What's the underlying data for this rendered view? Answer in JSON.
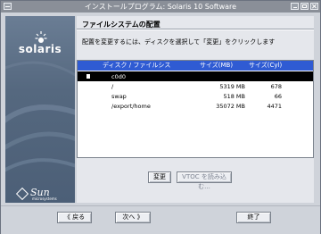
{
  "window": {
    "title": "インストールプログラム: Solaris 10 Software"
  },
  "sidebar": {
    "product_logo": "solaris",
    "vendor_logo": "Sun",
    "vendor_tagline": "microsystems"
  },
  "main": {
    "section_title": "ファイルシステムの配置",
    "instruction": "配置を変更するには、ディスクを選択して「変更」をクリックします",
    "table": {
      "headers": [
        "ディスク / ファイルシス",
        "サイズ(MB)",
        "サイズ(Cyl)"
      ],
      "rows": [
        {
          "name": "c0d0",
          "size_mb": "",
          "size_cyl": "",
          "type": "disk",
          "selected": true
        },
        {
          "name": "/",
          "size_mb": "5319 MB",
          "size_cyl": "678",
          "type": "fs",
          "selected": false
        },
        {
          "name": "swap",
          "size_mb": "518 MB",
          "size_cyl": "66",
          "type": "fs",
          "selected": false
        },
        {
          "name": "/export/home",
          "size_mb": "35072 MB",
          "size_cyl": "4471",
          "type": "fs",
          "selected": false
        }
      ]
    },
    "buttons": {
      "change": "変更",
      "read_vtoc": "VTOC を読み込む..."
    }
  },
  "footer": {
    "back": "《 戻る",
    "next": "次へ 》",
    "exit": "終了"
  },
  "colors": {
    "header_blue": "#2f5bd3",
    "selected_row": "#000000",
    "sidebar": "#55687f"
  }
}
